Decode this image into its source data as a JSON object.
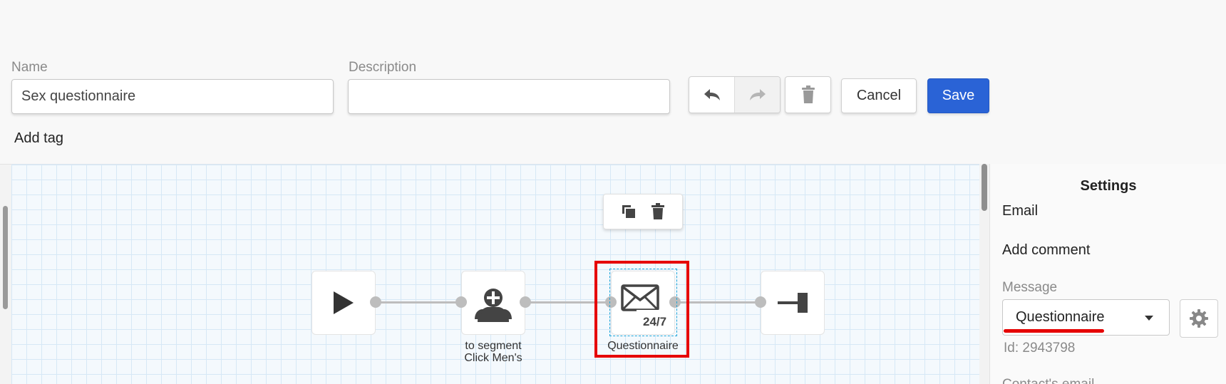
{
  "form": {
    "name_label": "Name",
    "name_value": "Sex questionnaire",
    "description_label": "Description",
    "description_value": "",
    "add_tag": "Add tag"
  },
  "toolbar": {
    "undo_icon": "undo-icon",
    "redo_icon": "redo-icon",
    "delete_icon": "trash-icon",
    "cancel_label": "Cancel",
    "save_label": "Save",
    "save_color": "#2a63d6"
  },
  "canvas": {
    "nodes": [
      {
        "icon": "play-icon",
        "label_line1": "",
        "label_line2": ""
      },
      {
        "icon": "add-user-to-segment-icon",
        "label_line1": "to segment",
        "label_line2": "Click Men's"
      },
      {
        "icon": "email-24-7-icon",
        "badge": "24/7",
        "label_line1": "Questionnaire",
        "label_line2": ""
      },
      {
        "icon": "end-icon",
        "label_line1": "",
        "label_line2": ""
      }
    ],
    "node_toolbar": {
      "copy_icon": "copy-icon",
      "delete_icon": "trash-icon"
    },
    "highlight_color": "#e60000"
  },
  "settings": {
    "title": "Settings",
    "type": "Email",
    "add_comment": "Add comment",
    "message_label": "Message",
    "message_value": "Questionnaire",
    "id_text": "Id: 2943798",
    "next_label_partial": "Contact's email"
  }
}
